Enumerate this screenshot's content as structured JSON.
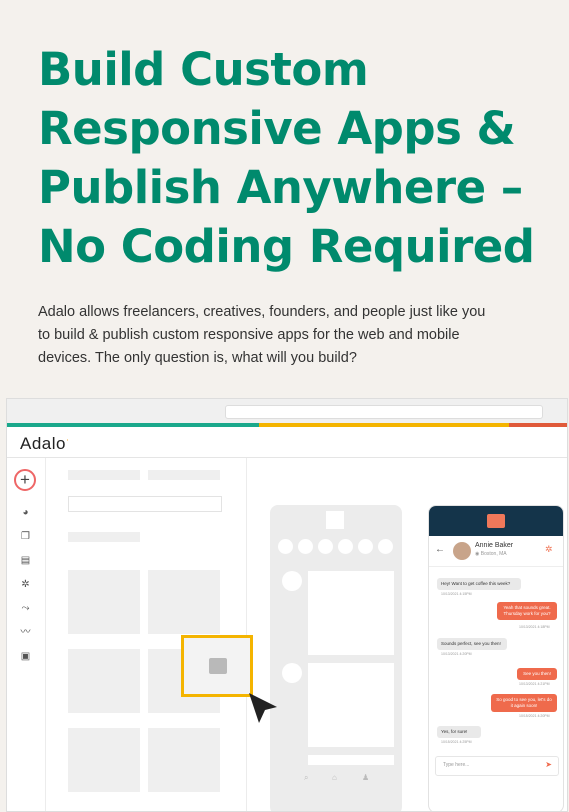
{
  "headline": [
    "Build Custom",
    "Responsive Apps &",
    "Publish Anywhere –",
    "No Coding Required"
  ],
  "intro": [
    "Adalo allows freelancers, creatives, founders, and people just like you",
    "to build & publish custom responsive apps for the web and mobile",
    "devices. The only question is, what will you build?"
  ],
  "app": {
    "logo": "Adalo",
    "logo_mark": "·",
    "add_glyph": "+",
    "stripe_colors": [
      "#1aa88b",
      "#f4b400",
      "#e05a3a"
    ],
    "rail_icons": [
      "palette-icon",
      "screens-icon",
      "database-icon",
      "settings-icon",
      "analytics-icon",
      "trends-icon",
      "publish-icon"
    ]
  },
  "builder_phone": {
    "nav_icons": [
      "search-icon",
      "home-icon",
      "profile-icon"
    ]
  },
  "chat": {
    "contact_name": "Annie Baker",
    "contact_location": "◉ Boston, MA",
    "back_glyph": "←",
    "settings_glyph": "✲",
    "messages": [
      {
        "from": "in",
        "text": "Hey! Want to get coffee this week?",
        "time": "10/13/2021 4:15PM"
      },
      {
        "from": "out",
        "text": "Yeah that sounds great. Thursday work for you?",
        "time": "10/13/2021 4:18PM"
      },
      {
        "from": "in",
        "text": "Sounds perfect, see you then!",
        "time": "10/13/2021 4:20PM"
      },
      {
        "from": "out",
        "text": "See you then!",
        "time": "10/13/2021 4:21PM"
      },
      {
        "from": "out",
        "text": "So good to see you, let's do it again soon!",
        "time": "10/15/2021 4:20PM"
      },
      {
        "from": "in",
        "text": "Yes, for sure!",
        "time": "10/15/2021 4:25PM"
      }
    ],
    "composer_placeholder": "Type here...",
    "send_glyph": "➤"
  }
}
